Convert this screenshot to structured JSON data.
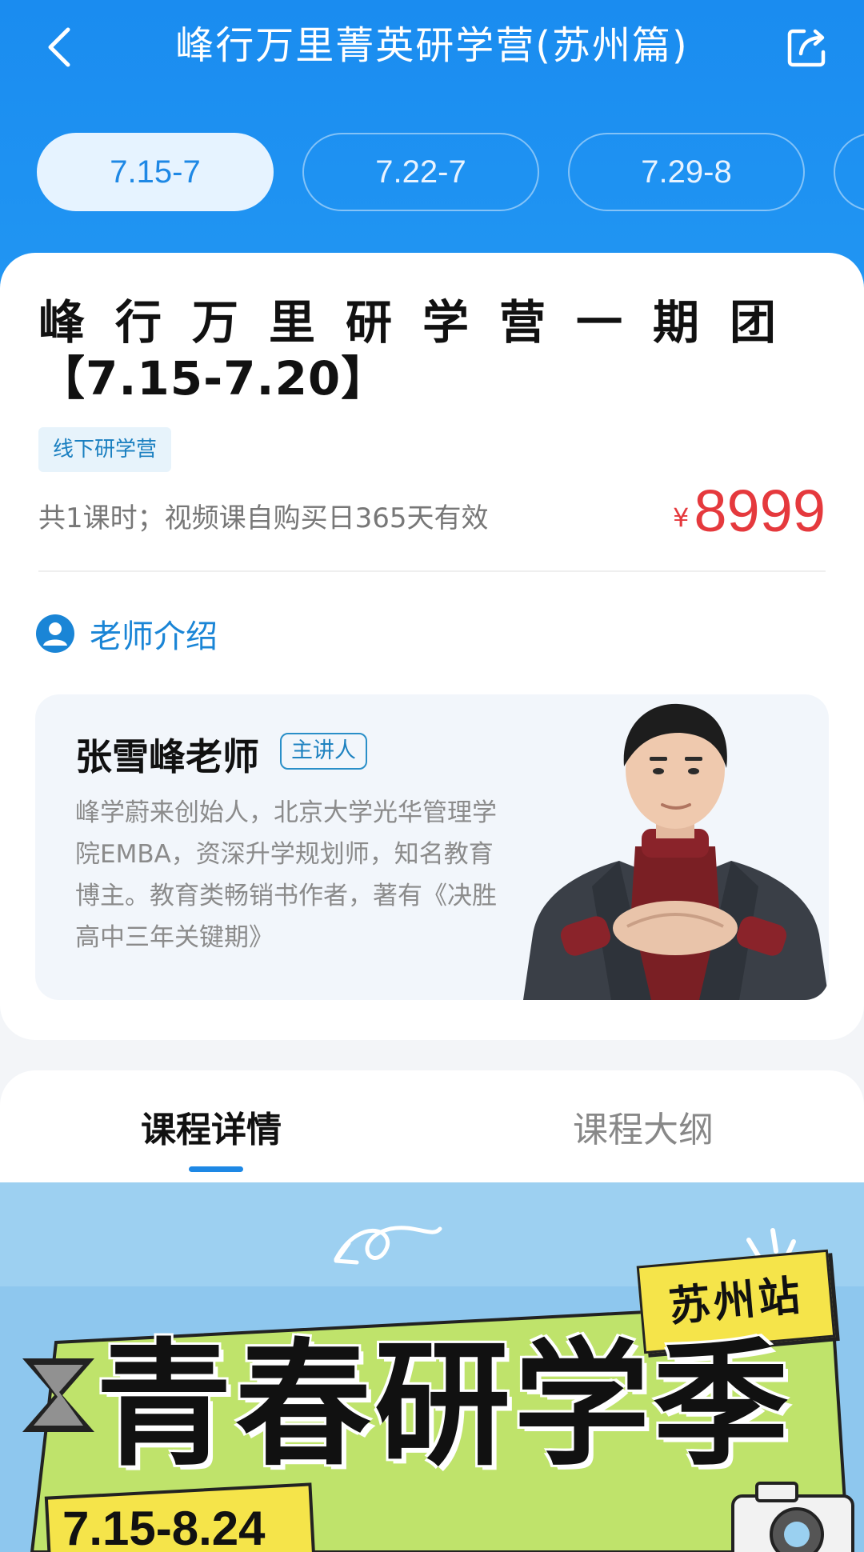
{
  "header": {
    "title": "峰行万里菁英研学营(苏州篇)",
    "back_icon": "back-arrow-icon",
    "share_icon": "share-icon",
    "bg_color": "#2196f3"
  },
  "date_tabs": [
    {
      "label": "7.15-7",
      "active": true
    },
    {
      "label": "7.22-7",
      "active": false
    },
    {
      "label": "7.29-8",
      "active": false
    }
  ],
  "course": {
    "title_line1": "峰行万里研学营一期团",
    "title_line2": "【7.15-7.20】",
    "tag": "线下研学营",
    "meta": "共1课时；视频课自购买日365天有效",
    "price_symbol": "¥",
    "price": "8999",
    "price_color": "#e5393d"
  },
  "teacher_section": {
    "heading": "老师介绍",
    "icon": "user-avatar-icon"
  },
  "teacher": {
    "name": "张雪峰老师",
    "role": "主讲人",
    "bio": "峰学蔚来创始人，北京大学光华管理学院EMBA，资深升学规划师，知名教育博主。教育类畅销书作者，著有《决胜高中三年关键期》"
  },
  "detail_tabs": [
    {
      "label": "课程详情",
      "active": true
    },
    {
      "label": "课程大纲",
      "active": false
    }
  ],
  "banner": {
    "station": "苏州站",
    "title": "青春研学季",
    "dates": "7.15-8.24"
  }
}
